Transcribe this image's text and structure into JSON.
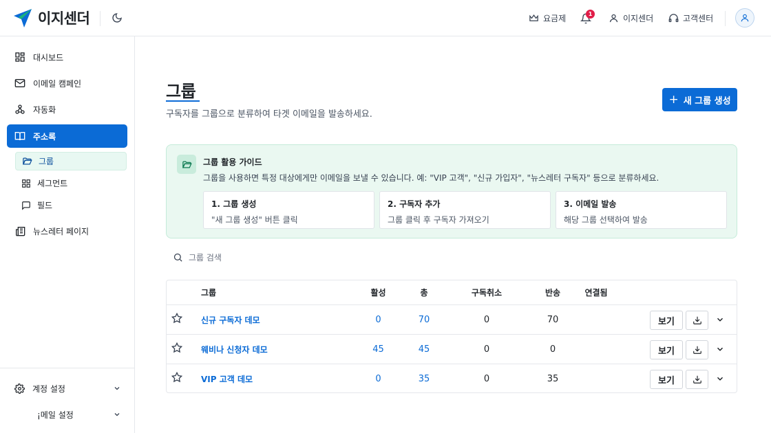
{
  "header": {
    "logo_text": "이지센더",
    "nav": [
      {
        "label": "요금제",
        "icon": "crown-icon"
      },
      {
        "label": "1",
        "icon": "bell-icon"
      },
      {
        "label": "이지센더",
        "icon": "user-icon"
      },
      {
        "label": "고객센터",
        "icon": "headset-icon"
      }
    ]
  },
  "sidebar": {
    "items": [
      {
        "label": "대시보드",
        "icon": "dashboard-icon"
      },
      {
        "label": "이메일 캠페인",
        "icon": "mail-icon"
      },
      {
        "label": "자동화",
        "icon": "automation-icon"
      },
      {
        "label": "주소록",
        "icon": "book-icon"
      },
      {
        "label": "뉴스레터 페이지",
        "icon": "newspaper-icon"
      }
    ],
    "subitems": [
      {
        "label": "그룹",
        "icon": "folder-open-icon"
      },
      {
        "label": "세그먼트",
        "icon": "grid-icon"
      },
      {
        "label": "필드",
        "icon": "message-square-icon"
      }
    ],
    "footer": [
      {
        "label": "계정 설정",
        "icon": "gear-icon"
      },
      {
        "label": "¡메일 설정",
        "icon": ""
      }
    ]
  },
  "main": {
    "title": "그룹",
    "subtitle": "구독자를 그룹으로 분류하여 타겟 이메일을 발송하세요.",
    "new_button": "새 그룹 생성",
    "guide": {
      "title": "그룹 활용 가이드",
      "description": "그룹을 사용하면 특정 대상에게만 이메일을 보낼 수 있습니다. 예: \"VIP 고객\", \"신규 가입자\", \"뉴스레터 구독자\" 등으로 분류하세요.",
      "steps": [
        {
          "title": "1. 그룹 생성",
          "desc": "\"새 그룹 생성\" 버튼 클릭"
        },
        {
          "title": "2. 구독자 추가",
          "desc": "그룹 클릭 후 구독자 가져오기"
        },
        {
          "title": "3. 이메일 발송",
          "desc": "해당 그룹 선택하여 발송"
        }
      ]
    },
    "search_placeholder": "그룹 검색",
    "table": {
      "columns": [
        "그룹",
        "활성",
        "총",
        "구독취소",
        "반송",
        "연결됨"
      ],
      "view_label": "보기",
      "rows": [
        {
          "name": "신규 구독자 데모",
          "active": "0",
          "total": "70",
          "unsubscribed": "0",
          "bounced": "70",
          "connected": ""
        },
        {
          "name": "웨비나 신청자 데모",
          "active": "45",
          "total": "45",
          "unsubscribed": "0",
          "bounced": "0",
          "connected": ""
        },
        {
          "name": "VIP 고객 데모",
          "active": "0",
          "total": "35",
          "unsubscribed": "0",
          "bounced": "35",
          "connected": ""
        }
      ]
    }
  },
  "colors": {
    "accent": "#0b6bd6",
    "guide_bg": "#eaf8f1",
    "badge": "#e11d48"
  }
}
